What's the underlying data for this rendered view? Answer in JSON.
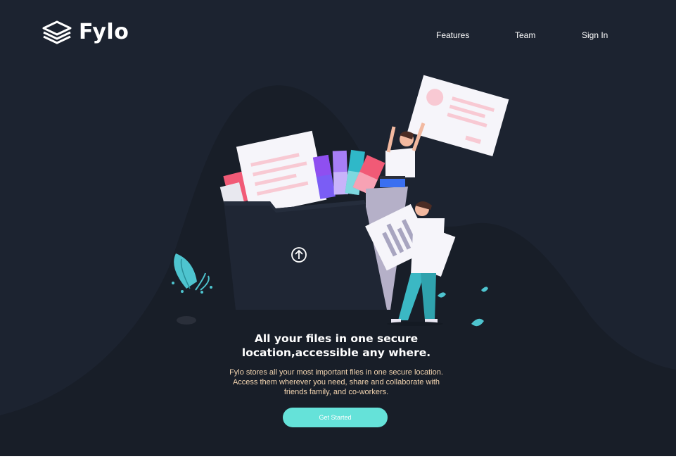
{
  "brand": {
    "name": "Fylo",
    "logo_icon": "stacked-layers-icon"
  },
  "nav": {
    "items": [
      {
        "label": "Features"
      },
      {
        "label": "Team"
      },
      {
        "label": "Sign In"
      }
    ]
  },
  "hero": {
    "illustration": "people-uploading-files-illustration",
    "upload_icon": "arrow-up-circle-icon",
    "headline": "All your files in one secure location,accessible any where.",
    "description": "Fylo stores all your most important files in one secure location. Access them wherever you need, share and collaborate with friends family, and co-workers.",
    "cta_label": "Get Started"
  },
  "colors": {
    "background": "#1c2330",
    "curve": "#181e28",
    "accent": "#65e2d9",
    "description_text": "#f2d4b0",
    "text": "#ffffff"
  }
}
